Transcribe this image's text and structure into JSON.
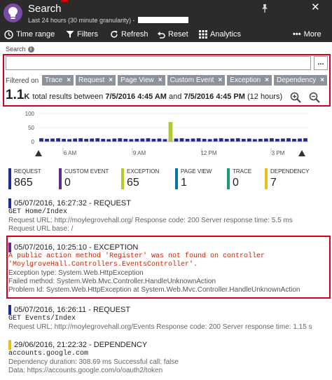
{
  "header": {
    "title": "Search",
    "subtitle": "Last 24 hours (30 minute granularity) -"
  },
  "toolbar": {
    "time_range": "Time range",
    "filters": "Filters",
    "refresh": "Refresh",
    "reset": "Reset",
    "analytics": "Analytics",
    "more": "More"
  },
  "search": {
    "label": "Search",
    "placeholder": "",
    "value": "",
    "more": "..."
  },
  "filters": {
    "label": "Filtered on",
    "chips": [
      "Trace",
      "Request",
      "Page View",
      "Custom Event",
      "Exception",
      "Dependency"
    ]
  },
  "total": {
    "count": "1.1",
    "unit": "K",
    "text": "total results between",
    "start": "7/5/2016 4:45 AM",
    "and": "and",
    "end": "7/5/2016 4:45 PM",
    "duration": "(12 hours)"
  },
  "chart_data": {
    "type": "bar",
    "y_ticks": [
      "100",
      "50",
      "0"
    ],
    "ylim": [
      0,
      100
    ],
    "x_ticks": [
      "6 AM",
      "9 AM",
      "12 PM",
      "3 PM"
    ],
    "series": [
      {
        "color": "#1d2c94",
        "values": [
          12,
          10,
          11,
          12,
          10,
          9,
          11,
          12,
          10,
          11,
          12,
          10,
          9,
          11,
          12,
          10,
          9,
          10,
          11,
          12,
          10,
          11,
          9,
          10,
          11,
          12,
          10,
          11,
          12,
          10,
          9,
          11,
          12,
          10,
          11,
          12,
          10,
          11,
          9,
          10,
          11,
          12,
          10,
          11,
          12,
          10,
          11,
          12
        ]
      },
      {
        "color": "#b5c92d",
        "values": [
          0,
          0,
          0,
          0,
          0,
          0,
          0,
          0,
          0,
          0,
          0,
          0,
          0,
          0,
          0,
          0,
          0,
          0,
          0,
          0,
          0,
          0,
          0,
          70,
          0,
          0,
          0,
          0,
          0,
          0,
          0,
          0,
          0,
          0,
          0,
          0,
          0,
          0,
          0,
          0,
          0,
          0,
          0,
          0,
          0,
          0,
          0,
          0
        ]
      }
    ]
  },
  "legend": [
    {
      "name": "REQUEST",
      "value": "865",
      "color": "#1d2c94"
    },
    {
      "name": "CUSTOM EVENT",
      "value": "0",
      "color": "#5c2d91"
    },
    {
      "name": "EXCEPTION",
      "value": "65",
      "color": "#b5c92d"
    },
    {
      "name": "PAGE VIEW",
      "value": "1",
      "color": "#0078a0"
    },
    {
      "name": "TRACE",
      "value": "0",
      "color": "#1a9b6c"
    },
    {
      "name": "DEPENDENCY",
      "value": "7",
      "color": "#e6c21c"
    }
  ],
  "entries": [
    {
      "title": "05/07/2016, 16:27:32 - REQUEST",
      "color": "#1d2c94",
      "mono": "GET Home/Index",
      "line1": "Request URL: http://moylegrovehall.org/  Response code: 200  Server response time: 5.5 ms",
      "line2": "Request URL base: /"
    },
    {
      "title": "05/07/2016, 10:25:10 - EXCEPTION",
      "color": "#5c2d91",
      "desc": "A public action method 'Register' was not found on controller 'MoylgroveHall.Controllers.EventsController'.",
      "line1": "Exception type: System.Web.HttpException",
      "line2": "Failed method: System.Web.Mvc.Controller.HandleUnknownAction",
      "line3": "Problem Id: System.Web.HttpException at System.Web.Mvc.Controller.HandleUnknownAction"
    },
    {
      "title": "05/07/2016, 16:26:11 - REQUEST",
      "color": "#1d2c94",
      "mono": "GET Events/Index",
      "line1": "Request URL: http://moylegrovehall.org/Events  Response code: 200  Server response time: 1.15 s"
    },
    {
      "title": "29/06/2016, 21:22:32 - DEPENDENCY",
      "color": "#e6c21c",
      "mono": "accounts.google.com",
      "line1": "Dependency duration: 308.69 ms  Successful call: false",
      "line2": "Data: https://accounts.google.com/o/oauth2/token"
    }
  ]
}
